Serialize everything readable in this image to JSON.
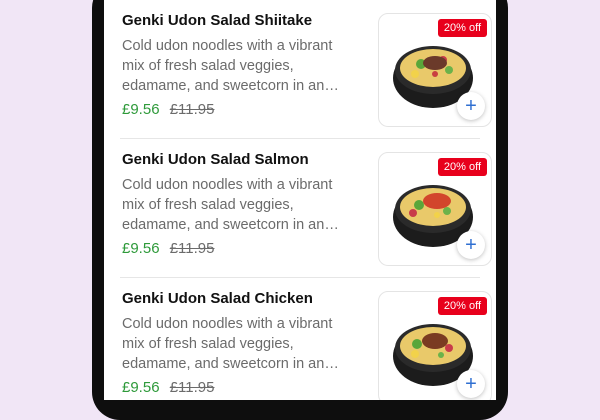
{
  "menu": {
    "items": [
      {
        "name": "Genki Udon Salad Shiitake",
        "description": "Cold udon noodles with a vibrant mix of fresh salad veggies, edamame, and sweetcorn in an…",
        "price": "£9.56",
        "original_price": "£11.95",
        "badge": "20% off",
        "add_symbol": "+",
        "topping_color": "#6b3a2a"
      },
      {
        "name": "Genki Udon Salad Salmon",
        "description": "Cold udon noodles with a vibrant mix of fresh salad veggies, edamame, and sweetcorn in an…",
        "price": "£9.56",
        "original_price": "£11.95",
        "badge": "20% off",
        "add_symbol": "+",
        "topping_color": "#d2452c"
      },
      {
        "name": "Genki Udon Salad Chicken",
        "description": "Cold udon noodles with a vibrant mix of fresh salad veggies, edamame, and sweetcorn in an…",
        "price": "£9.56",
        "original_price": "£11.95",
        "badge": "20% off",
        "add_symbol": "+",
        "topping_color": "#7a3b22"
      }
    ]
  },
  "theme": {
    "price_color": "#2e9a3a",
    "badge_color": "#e8001c",
    "add_icon_color": "#2f6fd1"
  }
}
